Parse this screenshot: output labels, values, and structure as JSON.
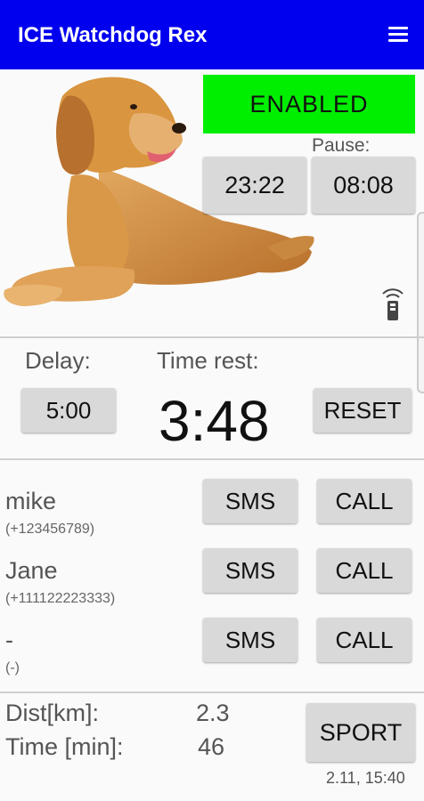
{
  "app": {
    "title": "ICE Watchdog Rex"
  },
  "icons": {
    "menu": "hamburger-menu-icon",
    "remote": "remote-signal-icon",
    "dog": "golden-retriever-image"
  },
  "status": {
    "enabled_label": "ENABLED",
    "enabled_color": "#00ee00",
    "pause_label": "Pause:"
  },
  "times": {
    "left": "23:22",
    "right": "08:08"
  },
  "timer": {
    "delay_label": "Delay:",
    "delay_value": "5:00",
    "time_rest_label": "Time rest:",
    "time_rest_value": "3:48",
    "reset_label": "RESET"
  },
  "contacts": [
    {
      "name": "mike",
      "number": "(+123456789)",
      "sms": "SMS",
      "call": "CALL"
    },
    {
      "name": "Jane",
      "number": "(+111122223333)",
      "sms": "SMS",
      "call": "CALL"
    },
    {
      "name": "-",
      "number": "(-)",
      "sms": "SMS",
      "call": "CALL"
    }
  ],
  "stats": {
    "dist_label": "Dist[km]:",
    "dist_value": "2.3",
    "time_label": "Time [min]:",
    "time_value": "46",
    "sport_label": "SPORT",
    "timestamp": "2.11, 15:40"
  },
  "colors": {
    "appbar": "#0000ee",
    "button": "#d9d9d9",
    "enabled": "#00ee00"
  }
}
